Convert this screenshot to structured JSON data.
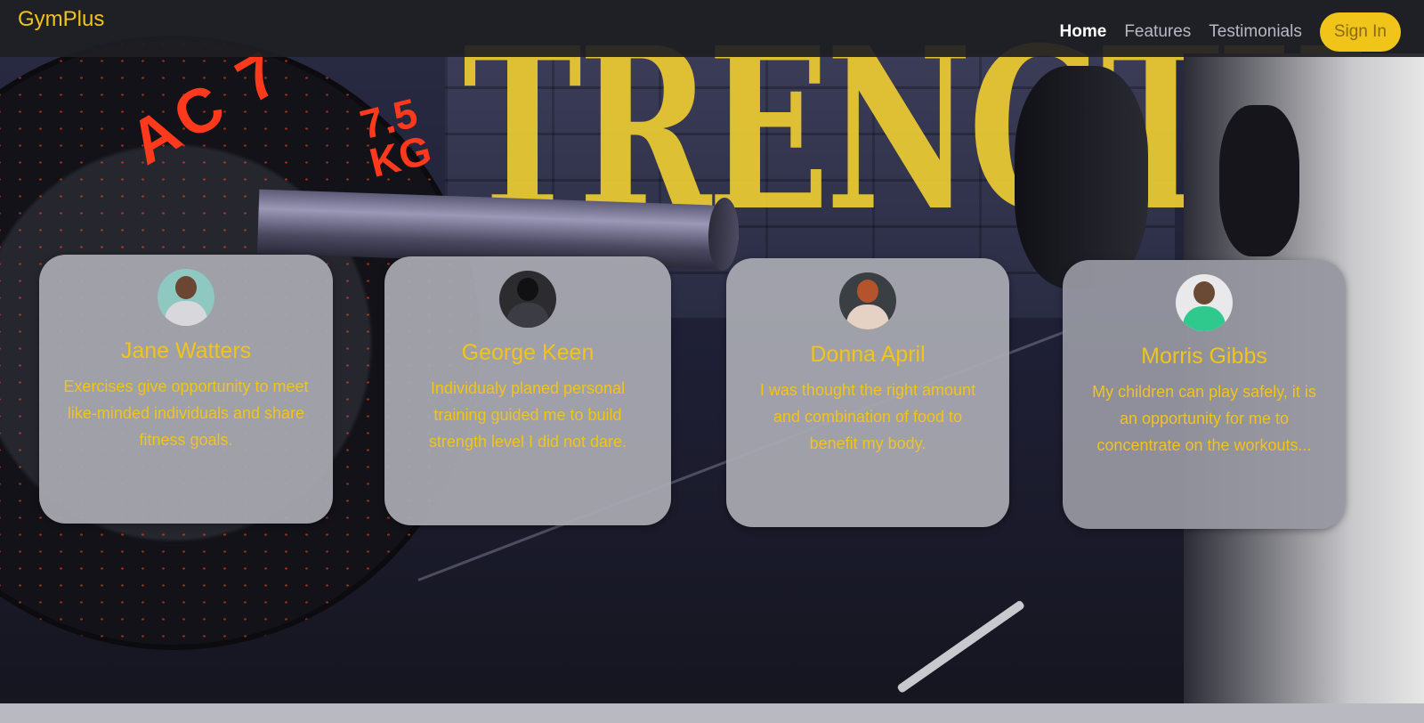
{
  "app": {
    "brand": "GymPlus"
  },
  "nav": {
    "links": [
      {
        "label": "Home",
        "active": true
      },
      {
        "label": "Features",
        "active": false
      },
      {
        "label": "Testimonials",
        "active": false
      }
    ],
    "signin_label": "Sign In"
  },
  "background": {
    "wall_text": "TRENGTH",
    "plate_text": "7.5\nKG",
    "plate_arc_text": "AC 7"
  },
  "testimonials": [
    {
      "name": "Jane Watters",
      "quote": "Exercises give opportunity to meet like-minded individuals and share fitness goals.",
      "avatar_icon": "person-avatar-icon"
    },
    {
      "name": "George Keen",
      "quote": "Individualy planed personal training guided me to build strength level I did not dare.",
      "avatar_icon": "person-avatar-icon"
    },
    {
      "name": "Donna April",
      "quote": "I was thought the right amount and combination of food to benefit my body.",
      "avatar_icon": "person-avatar-icon"
    },
    {
      "name": "Morris Gibbs",
      "quote": "My children can play safely, it is an opportunity for me to concentrate on the workouts...",
      "avatar_icon": "person-avatar-icon"
    }
  ],
  "colors": {
    "accent": "#f0c419",
    "card": "#a8a9b0",
    "navbar": "#1e1e24"
  }
}
